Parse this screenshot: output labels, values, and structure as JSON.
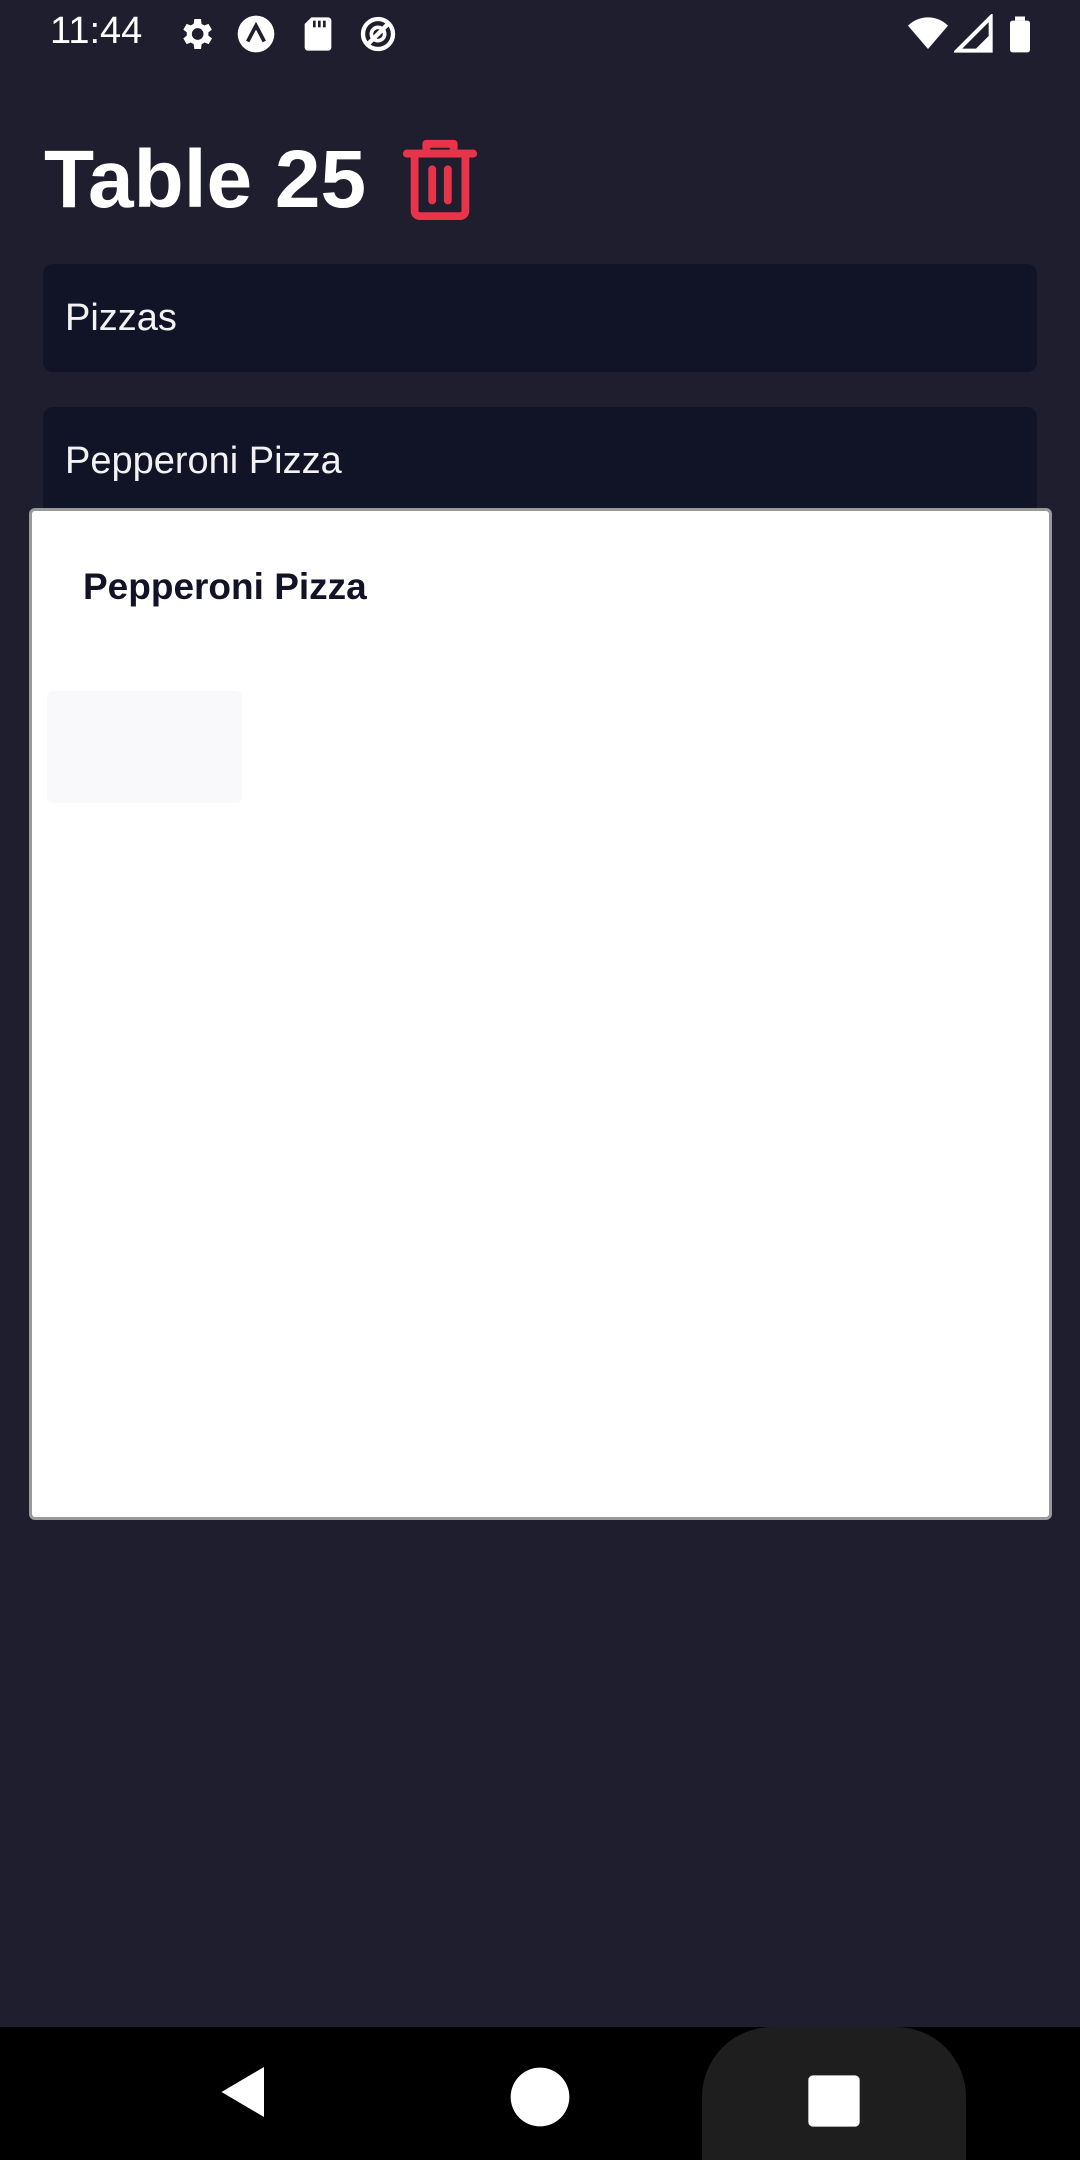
{
  "status_bar": {
    "time": "11:44",
    "icons": [
      "gear-icon",
      "expo-icon",
      "sd-card-icon",
      "no-sync-icon",
      "wifi-icon",
      "signal-icon",
      "battery-icon"
    ]
  },
  "header": {
    "title": "Table 25",
    "delete_icon": "trash-icon"
  },
  "categories": [
    {
      "label": "Pizzas"
    },
    {
      "label": "Pepperoni Pizza"
    }
  ],
  "modal": {
    "title": "Pepperoni Pizza"
  },
  "nav_bar": {
    "buttons": [
      "back-icon",
      "home-icon",
      "recents-icon"
    ]
  },
  "colors": {
    "background": "#1f1e2e",
    "row_background": "#111327",
    "accent_red": "#e8344a",
    "modal_title": "#121326"
  }
}
